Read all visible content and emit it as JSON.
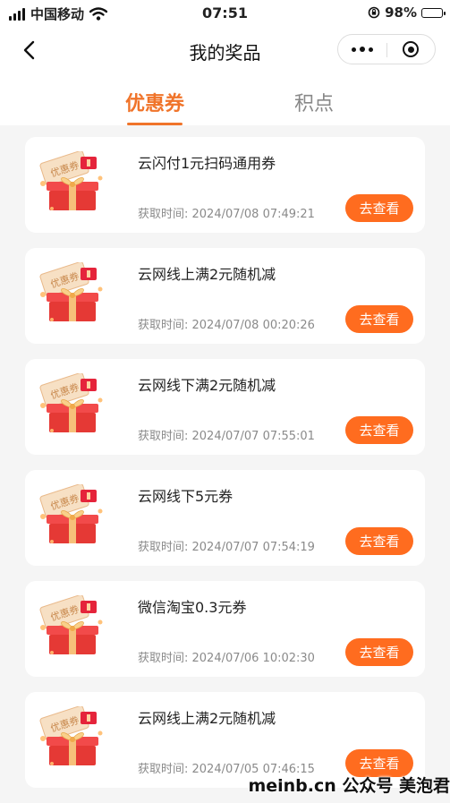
{
  "status_bar": {
    "carrier": "中国移动",
    "time": "07:51",
    "battery": "98%",
    "battery_level": 0.98
  },
  "nav": {
    "title": "我的奖品"
  },
  "tabs": [
    {
      "label": "优惠券",
      "active": true
    },
    {
      "label": "积点",
      "active": false
    }
  ],
  "colors": {
    "accent": "#f0742a",
    "button": "#ff6c1f"
  },
  "coupons": [
    {
      "title": "云闪付1元扫码通用券",
      "time": "获取时间: 2024/07/08 07:49:21",
      "button": "去查看"
    },
    {
      "title": "云网线上满2元随机减",
      "time": "获取时间: 2024/07/08 00:20:26",
      "button": "去查看"
    },
    {
      "title": "云网线下满2元随机减",
      "time": "获取时间: 2024/07/07 07:55:01",
      "button": "去查看"
    },
    {
      "title": "云网线下5元券",
      "time": "获取时间: 2024/07/07 07:54:19",
      "button": "去查看"
    },
    {
      "title": "微信淘宝0.3元券",
      "time": "获取时间: 2024/07/06 10:02:30",
      "button": "去查看"
    },
    {
      "title": "云网线上满2元随机减",
      "time": "获取时间: 2024/07/05 07:46:15",
      "button": "去查看"
    }
  ],
  "gift_icon_text": "优惠券",
  "watermark": "meinb.cn 公众号 美泡君"
}
